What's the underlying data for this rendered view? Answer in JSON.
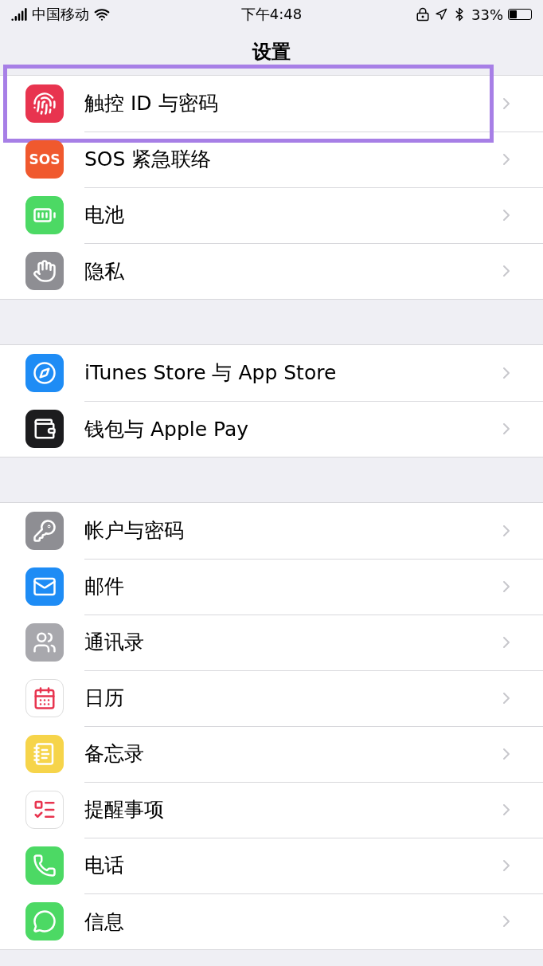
{
  "status_bar": {
    "carrier": "中国移动",
    "time": "下午4:48",
    "battery": "33%"
  },
  "nav": {
    "title": "设置"
  },
  "groups": [
    {
      "rows": [
        {
          "label": "触控 ID 与密码",
          "color": "#e8344f",
          "highlighted": true
        },
        {
          "label": "SOS 紧急联络",
          "color": "#f0592e",
          "icon_text": "SOS",
          "highlighted": false
        },
        {
          "label": "电池",
          "color": "#4cd964",
          "highlighted": false
        },
        {
          "label": "隐私",
          "color": "#8e8e93",
          "highlighted": false
        }
      ]
    },
    {
      "rows": [
        {
          "label": "iTunes Store 与 App Store",
          "color": "#1e8cf5",
          "highlighted": false
        },
        {
          "label": "钱包与 Apple Pay",
          "color": "#1c1c1e",
          "highlighted": false
        }
      ]
    },
    {
      "rows": [
        {
          "label": "帐户与密码",
          "color": "#8e8e93",
          "highlighted": false
        },
        {
          "label": "邮件",
          "color": "#1e8cf5",
          "highlighted": false
        },
        {
          "label": "通讯录",
          "color": "#a8a8ad",
          "highlighted": false
        },
        {
          "label": "日历",
          "color": "#ffffff",
          "highlighted": false
        },
        {
          "label": "备忘录",
          "color": "#f6d44a",
          "highlighted": false
        },
        {
          "label": "提醒事项",
          "color": "#ffffff",
          "highlighted": false
        },
        {
          "label": "电话",
          "color": "#4cd964",
          "highlighted": false
        },
        {
          "label": "信息",
          "color": "#4cd964",
          "highlighted": false
        }
      ]
    }
  ]
}
